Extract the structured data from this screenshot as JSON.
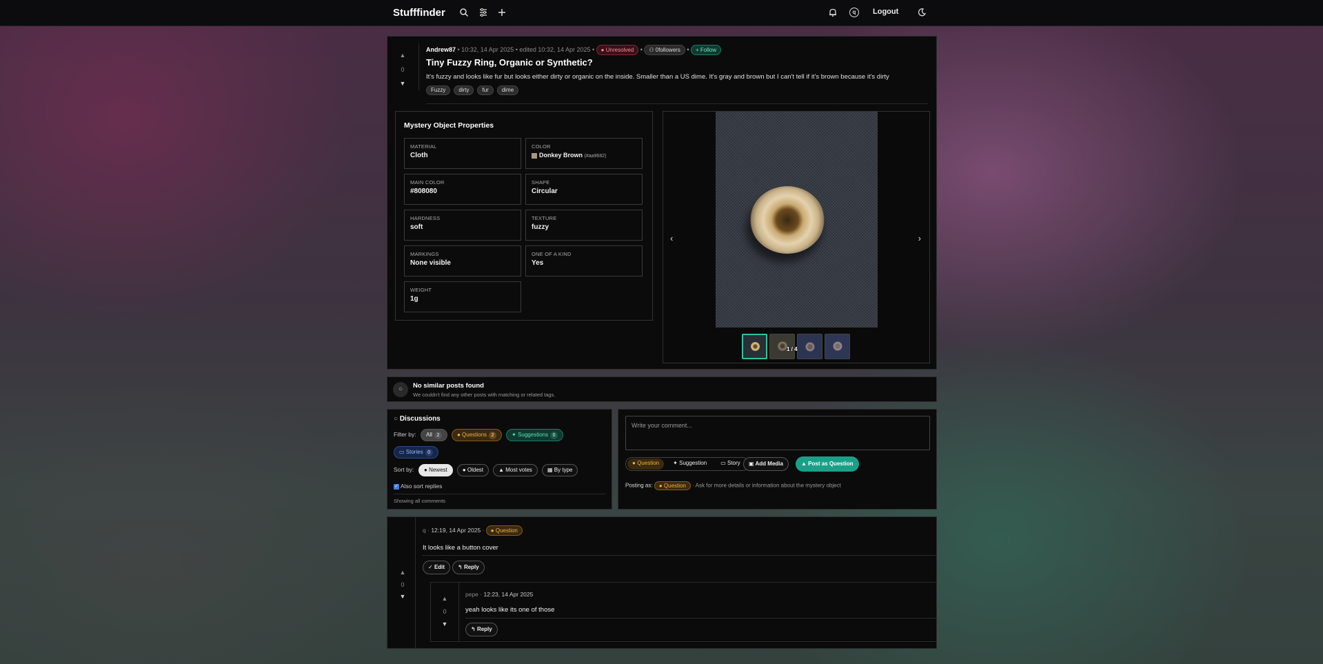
{
  "app": {
    "brand": "Stufffinder",
    "logout": "Logout"
  },
  "post": {
    "author": "Andrew87",
    "meta": "• 10:32, 14 Apr 2025 • edited 10:32, 14 Apr 2025 •",
    "status": "Unresolved",
    "followers": "0followers",
    "follow": "Follow",
    "votes": "0",
    "title": "Tiny Fuzzy Ring, Organic or Synthetic?",
    "body": "It's fuzzy and looks like fur but looks either dirty or organic on the inside. Smaller than a US dime. It's gray and brown but I can't tell if it's brown because it's dirty",
    "tags": [
      "Fuzzy",
      "dirty",
      "fur",
      "dime"
    ]
  },
  "properties": {
    "title": "Mystery Object Properties",
    "items": [
      {
        "key": "MATERIAL",
        "value": "Cloth"
      },
      {
        "key": "COLOR",
        "value": "Donkey Brown",
        "hex": "(#aa9682)",
        "swatch": "#aa9682"
      },
      {
        "key": "MAIN COLOR",
        "value": "#808080"
      },
      {
        "key": "SHAPE",
        "value": "Circular"
      },
      {
        "key": "HARDNESS",
        "value": "soft"
      },
      {
        "key": "TEXTURE",
        "value": "fuzzy"
      },
      {
        "key": "MARKINGS",
        "value": "None visible"
      },
      {
        "key": "ONE OF A KIND",
        "value": "Yes"
      },
      {
        "key": "WEIGHT",
        "value": "1g"
      }
    ]
  },
  "gallery": {
    "counter": "1 / 4"
  },
  "similar": {
    "title": "No similar posts found",
    "subtitle": "We couldn't find any other posts with matching or related tags."
  },
  "discussions": {
    "title": "Discussions",
    "filter_label": "Filter by:",
    "filters": [
      {
        "label": "All",
        "count": "2"
      },
      {
        "label": "Questions",
        "count": "2"
      },
      {
        "label": "Suggestions",
        "count": "0"
      },
      {
        "label": "Stories",
        "count": "0"
      }
    ],
    "sort_label": "Sort by:",
    "sorts": [
      "Newest",
      "Oldest",
      "Most votes",
      "By type"
    ],
    "also_sort": "Also sort replies",
    "showing": "Showing all comments"
  },
  "composer": {
    "placeholder": "Write your comment...",
    "types": [
      "Question",
      "Suggestion",
      "Story"
    ],
    "add_media": "Add Media",
    "post_button": "Post as Question",
    "posting_as": "Posting as:",
    "posting_type": "Question",
    "posting_hint": "· Ask for more details or information about the mystery object"
  },
  "comments": [
    {
      "author": "q",
      "time": "12:19, 14 Apr 2025",
      "type": "Question",
      "text": "It looks like a button cover",
      "votes": "0",
      "edit": "Edit",
      "reply": "Reply",
      "replies": [
        {
          "author": "pepe",
          "time": "12:23, 14 Apr 2025",
          "text": "yeah looks like its one of those",
          "votes": "0",
          "reply": "Reply"
        }
      ]
    }
  ]
}
